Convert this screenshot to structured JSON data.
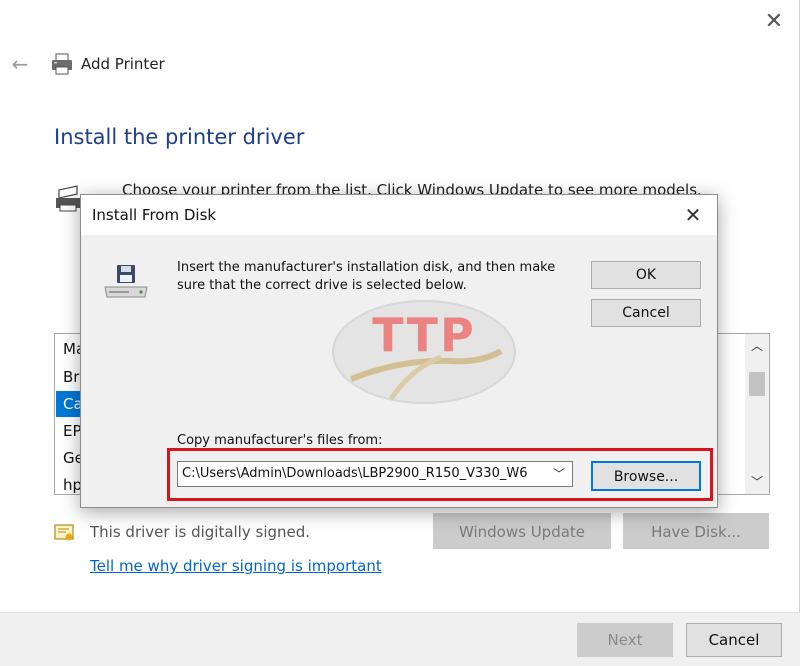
{
  "wizard": {
    "title": "Add Printer",
    "heading": "Install the printer driver",
    "instruction": "Choose your printer from the list. Click Windows Update to see more models.",
    "manufacturers": [
      "Ma",
      "Br",
      "Ca",
      "EP",
      "Ge",
      "hp"
    ],
    "selected_manufacturer_index": 2,
    "signed_text": "This driver is digitally signed.",
    "signing_link": "Tell me why driver signing is important",
    "windows_update_label": "Windows Update",
    "have_disk_label": "Have Disk...",
    "next_label": "Next",
    "cancel_label": "Cancel"
  },
  "dialog": {
    "title": "Install From Disk",
    "message": "Insert the manufacturer's installation disk, and then make sure that the correct drive is selected below.",
    "ok_label": "OK",
    "cancel_label": "Cancel",
    "copy_label": "Copy manufacturer's files from:",
    "path_value": "C:\\Users\\Admin\\Downloads\\LBP2900_R150_V330_W6",
    "browse_label": "Browse..."
  },
  "watermark": {
    "text": "TTP"
  },
  "colors": {
    "heading": "#1e3f8f",
    "selection": "#0078d7",
    "link": "#0066cc",
    "highlight": "#d8141d",
    "watermark": "#e82b2b"
  },
  "icons": {
    "close": "close-icon",
    "back": "back-arrow-icon",
    "printer": "printer-icon",
    "disk": "floppy-disk-drive-icon",
    "certificate": "certificate-icon"
  }
}
